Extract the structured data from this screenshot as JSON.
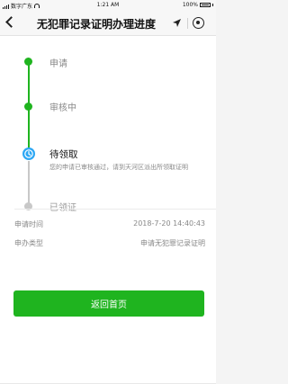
{
  "status_bar": {
    "carrier": "数字广东",
    "time": "1:21 AM",
    "battery": "100%"
  },
  "nav": {
    "title": "无犯罪记录证明办理进度"
  },
  "steps": [
    {
      "label": "申请",
      "state": "done"
    },
    {
      "label": "审核中",
      "state": "done"
    },
    {
      "label": "待领取",
      "state": "current",
      "description": "您的申请已审核通过，请到天河区派出所领取证明"
    },
    {
      "label": "已领证",
      "state": "pending"
    }
  ],
  "info": {
    "apply_time_label": "申请时间",
    "apply_time_value": "2018-7-20 14:40:43",
    "type_label": "申办类型",
    "type_value": "申请无犯罪记录证明"
  },
  "button": {
    "label": "返回首页"
  },
  "colors": {
    "accent_green": "#1fb41f",
    "current_blue": "#2ca7f4",
    "pending_gray": "#c8c8c8"
  },
  "icons": [
    "back-icon",
    "location-arrow-icon",
    "capsule-target-icon",
    "clock-icon"
  ]
}
